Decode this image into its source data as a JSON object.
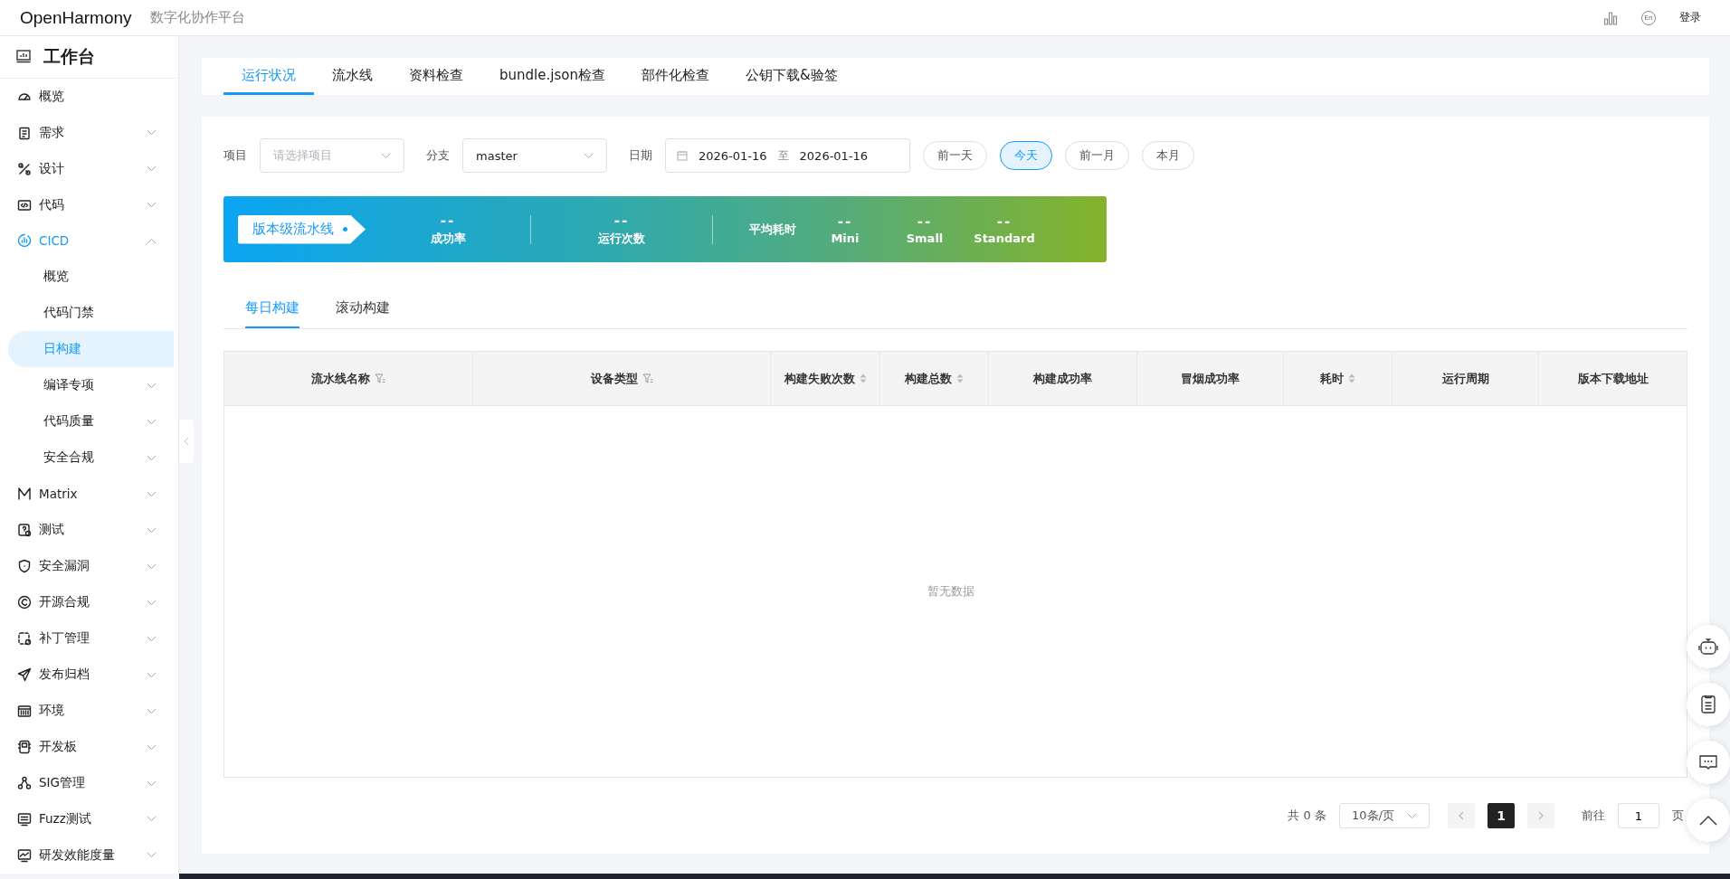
{
  "header": {
    "brand": "OpenHarmony",
    "subtitle": "数字化协作平台",
    "lang_label": "En",
    "login": "登录"
  },
  "sidebar": {
    "title": "工作台",
    "items": [
      {
        "label": "概览",
        "kind": "link",
        "selected": false
      },
      {
        "label": "需求",
        "kind": "group",
        "expanded": false,
        "selected": false
      },
      {
        "label": "设计",
        "kind": "group",
        "expanded": false,
        "selected": false
      },
      {
        "label": "代码",
        "kind": "group",
        "expanded": false,
        "selected": false
      },
      {
        "label": "CICD",
        "kind": "group",
        "expanded": true,
        "selected": true,
        "children": [
          {
            "label": "概览",
            "kind": "link",
            "selected": false
          },
          {
            "label": "代码门禁",
            "kind": "link",
            "selected": false
          },
          {
            "label": "日构建",
            "kind": "link",
            "selected": true
          },
          {
            "label": "编译专项",
            "kind": "group",
            "expanded": false,
            "selected": false
          },
          {
            "label": "代码质量",
            "kind": "group",
            "expanded": false,
            "selected": false
          },
          {
            "label": "安全合规",
            "kind": "group",
            "expanded": false,
            "selected": false
          }
        ]
      },
      {
        "label": "Matrix",
        "kind": "group",
        "expanded": false,
        "selected": false
      },
      {
        "label": "测试",
        "kind": "group",
        "expanded": false,
        "selected": false
      },
      {
        "label": "安全漏洞",
        "kind": "group",
        "expanded": false,
        "selected": false
      },
      {
        "label": "开源合规",
        "kind": "group",
        "expanded": false,
        "selected": false
      },
      {
        "label": "补丁管理",
        "kind": "group",
        "expanded": false,
        "selected": false
      },
      {
        "label": "发布归档",
        "kind": "group",
        "expanded": false,
        "selected": false
      },
      {
        "label": "环境",
        "kind": "group",
        "expanded": false,
        "selected": false
      },
      {
        "label": "开发板",
        "kind": "group",
        "expanded": false,
        "selected": false
      },
      {
        "label": "SIG管理",
        "kind": "group",
        "expanded": false,
        "selected": false
      },
      {
        "label": "Fuzz测试",
        "kind": "group",
        "expanded": false,
        "selected": false
      },
      {
        "label": "研发效能度量",
        "kind": "group",
        "expanded": false,
        "selected": false
      }
    ]
  },
  "tabs": [
    {
      "label": "运行状况",
      "selected": true
    },
    {
      "label": "流水线",
      "selected": false
    },
    {
      "label": "资料检查",
      "selected": false
    },
    {
      "label": "bundle.json检查",
      "selected": false
    },
    {
      "label": "部件化检查",
      "selected": false
    },
    {
      "label": "公钥下载&验签",
      "selected": false
    }
  ],
  "filters": {
    "project": {
      "label": "项目",
      "placeholder": "请选择项目"
    },
    "branch": {
      "label": "分支",
      "value": "master"
    },
    "date": {
      "label": "日期",
      "start": "2026-01-16",
      "separator": "至",
      "end": "2026-01-16"
    },
    "quick_buttons": [
      {
        "label": "前一天",
        "selected": false
      },
      {
        "label": "今天",
        "selected": true
      },
      {
        "label": "前一月",
        "selected": false
      },
      {
        "label": "本月",
        "selected": false
      }
    ]
  },
  "banner": {
    "tag": "版本级流水线",
    "stats": [
      {
        "value": "--",
        "label": "成功率"
      },
      {
        "value": "--",
        "label": "运行次数"
      }
    ],
    "avg_label": "平均耗时",
    "avg_stats": [
      {
        "value": "--",
        "label": "Mini"
      },
      {
        "value": "--",
        "label": "Small"
      },
      {
        "value": "--",
        "label": "Standard"
      }
    ]
  },
  "subtabs": [
    {
      "label": "每日构建",
      "selected": true
    },
    {
      "label": "滚动构建",
      "selected": false
    }
  ],
  "table": {
    "columns": [
      {
        "label": "流水线名称",
        "kind": "filter"
      },
      {
        "label": "设备类型",
        "kind": "filter"
      },
      {
        "label": "构建失败次数",
        "kind": "sort"
      },
      {
        "label": "构建总数",
        "kind": "sort"
      },
      {
        "label": "构建成功率",
        "kind": "plain"
      },
      {
        "label": "冒烟成功率",
        "kind": "plain"
      },
      {
        "label": "耗时",
        "kind": "sort"
      },
      {
        "label": "运行周期",
        "kind": "plain"
      },
      {
        "label": "版本下载地址",
        "kind": "plain"
      }
    ],
    "empty_text": "暂无数据"
  },
  "pagination": {
    "total": "共 0 条",
    "page_size": "10条/页",
    "pages": [
      {
        "label": "1",
        "selected": true
      }
    ],
    "goto_label": "前往",
    "goto_value": "1",
    "goto_suffix": "页"
  }
}
